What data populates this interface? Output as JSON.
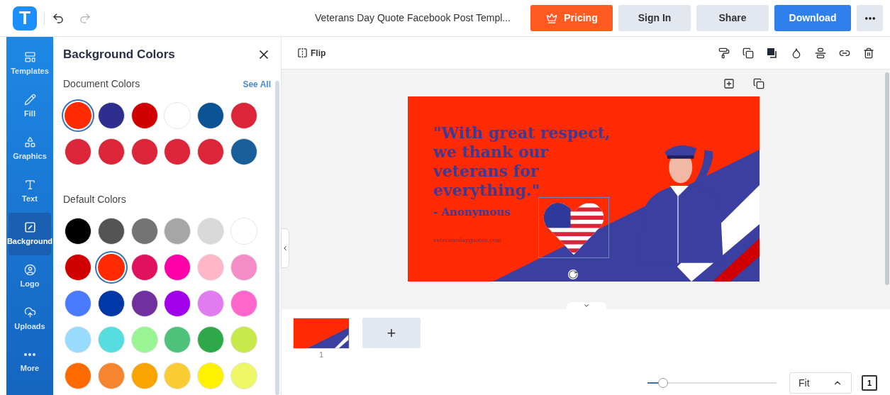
{
  "header": {
    "logo": "T",
    "title": "Veterans Day Quote Facebook Post Templ...",
    "buttons": [
      {
        "kind": "pricing",
        "label": "Pricing"
      },
      {
        "kind": "plain",
        "label": "Sign In"
      },
      {
        "kind": "plain",
        "label": "Share"
      },
      {
        "kind": "primary",
        "label": "Download"
      }
    ]
  },
  "sidebar": {
    "items": [
      {
        "kind": "templates",
        "label": "Templates",
        "selected": false
      },
      {
        "kind": "fill",
        "label": "Fill",
        "selected": false
      },
      {
        "kind": "graphics",
        "label": "Graphics",
        "selected": false
      },
      {
        "kind": "text",
        "label": "Text",
        "selected": false
      },
      {
        "kind": "background",
        "label": "Background",
        "selected": true
      },
      {
        "kind": "logo",
        "label": "Logo",
        "selected": false
      },
      {
        "kind": "uploads",
        "label": "Uploads",
        "selected": false
      },
      {
        "kind": "more",
        "label": "More",
        "selected": false
      }
    ]
  },
  "panel": {
    "title": "Background Colors",
    "document_colors": {
      "heading": "Document Colors",
      "link": "See All",
      "swatches": [
        {
          "color": "#ff2a00",
          "selected": true
        },
        {
          "color": "#2e2e8f",
          "selected": false
        },
        {
          "color": "#d10000",
          "selected": false
        },
        {
          "color": "#ffffff",
          "selected": false
        },
        {
          "color": "#0a5394",
          "selected": false
        },
        {
          "color": "#dc2538",
          "selected": false
        },
        {
          "color": "#dc2538",
          "selected": false
        },
        {
          "color": "#dc2538",
          "selected": false
        },
        {
          "color": "#dc2538",
          "selected": false
        },
        {
          "color": "#dc2538",
          "selected": false
        },
        {
          "color": "#dc2538",
          "selected": false
        },
        {
          "color": "#1a5e9a",
          "selected": false
        }
      ]
    },
    "default_colors": {
      "heading": "Default Colors",
      "swatches": [
        {
          "color": "#000000",
          "selected": false
        },
        {
          "color": "#545454",
          "selected": false
        },
        {
          "color": "#737373",
          "selected": false
        },
        {
          "color": "#a6a6a6",
          "selected": false
        },
        {
          "color": "#d9d9d9",
          "selected": false
        },
        {
          "color": "#ffffff",
          "selected": false
        },
        {
          "color": "#d10000",
          "selected": false
        },
        {
          "color": "#ff2a00",
          "selected": true
        },
        {
          "color": "#e0115f",
          "selected": false
        },
        {
          "color": "#ff00a8",
          "selected": false
        },
        {
          "color": "#ffb6c8",
          "selected": false
        },
        {
          "color": "#f48cc8",
          "selected": false
        },
        {
          "color": "#4a7aff",
          "selected": false
        },
        {
          "color": "#0038a8",
          "selected": false
        },
        {
          "color": "#7030a0",
          "selected": false
        },
        {
          "color": "#a000ea",
          "selected": false
        },
        {
          "color": "#e07cf0",
          "selected": false
        },
        {
          "color": "#ff66cc",
          "selected": false
        },
        {
          "color": "#99dbff",
          "selected": false
        },
        {
          "color": "#55dde0",
          "selected": false
        },
        {
          "color": "#99f594",
          "selected": false
        },
        {
          "color": "#4cc27a",
          "selected": false
        },
        {
          "color": "#2fa84a",
          "selected": false
        },
        {
          "color": "#c9e84a",
          "selected": false
        },
        {
          "color": "#ff6a00",
          "selected": false
        },
        {
          "color": "#f6852f",
          "selected": false
        },
        {
          "color": "#f9a400",
          "selected": false
        },
        {
          "color": "#f9cc33",
          "selected": false
        },
        {
          "color": "#fff200",
          "selected": false
        },
        {
          "color": "#eef866",
          "selected": false
        }
      ]
    }
  },
  "toolbar": {
    "flip": "Flip"
  },
  "design": {
    "quote": "\"With great respect, we thank our veterans for everything.\"",
    "author": "- Anonymous",
    "website": "veteransdayquotes.com"
  },
  "pages": {
    "thumbnails": [
      {
        "number": "1",
        "selected": true
      }
    ],
    "add": "+"
  },
  "zoom": {
    "level": 0.12,
    "fit": "Fit",
    "page_count": "1"
  }
}
